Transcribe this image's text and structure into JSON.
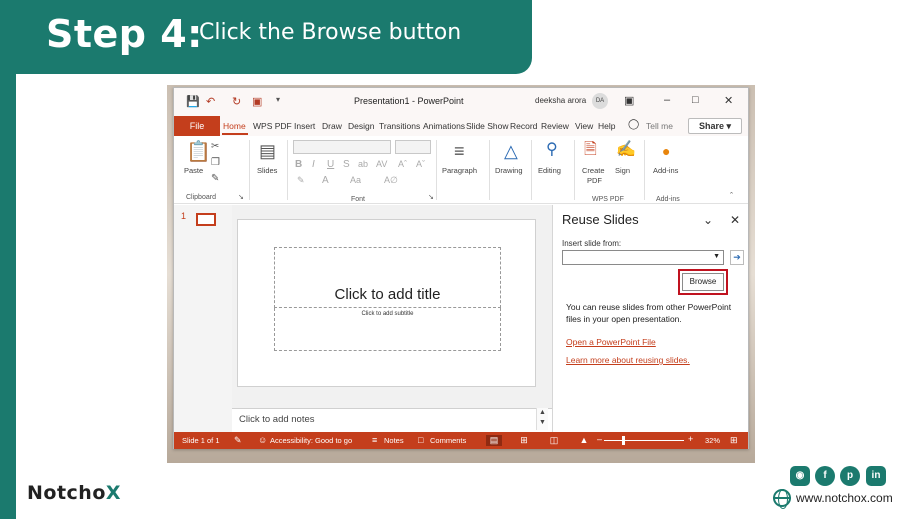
{
  "banner": {
    "step": "Step 4:",
    "instruction": "Click the Browse button"
  },
  "window": {
    "title": "Presentation1  -  PowerPoint",
    "user_name": "deeksha arora",
    "user_initials": "DA",
    "quick_access": [
      "save-icon",
      "undo-icon",
      "redo-icon",
      "present-icon"
    ]
  },
  "tabs": {
    "file": "File",
    "items": [
      "Home",
      "WPS PDF",
      "Insert",
      "Draw",
      "Design",
      "Transitions",
      "Animations",
      "Slide Show",
      "Record",
      "Review",
      "View",
      "Help"
    ],
    "active": "Home",
    "tell_me": "Tell me",
    "share": "Share"
  },
  "ribbon": {
    "paste": "Paste",
    "clipboard": "Clipboard",
    "slides": "Slides",
    "font": "Font",
    "paragraph": "Paragraph",
    "drawing": "Drawing",
    "editing": "Editing",
    "create_pdf_line1": "Create",
    "create_pdf_line2": "PDF",
    "sign": "Sign",
    "wps_pdf": "WPS PDF",
    "addins": "Add-ins",
    "addins_group": "Add-ins"
  },
  "thumbnails": {
    "slide_number": "1"
  },
  "slide": {
    "title_placeholder": "Click to add title",
    "subtitle_placeholder": "Click to add subtitle"
  },
  "notes": {
    "placeholder": "Click to add notes"
  },
  "reuse_slides": {
    "title": "Reuse Slides",
    "insert_from": "Insert slide from:",
    "select_value": "",
    "browse": "Browse",
    "description": "You can reuse slides from other PowerPoint files in your open presentation.",
    "open_link": "Open a PowerPoint File",
    "learn_link": "Learn more about reusing slides."
  },
  "status_bar": {
    "slide_of": "Slide 1 of 1",
    "accessibility": "Accessibility: Good to go",
    "notes": "Notes",
    "comments": "Comments",
    "zoom": "32%"
  },
  "footer": {
    "logo_prefix": "Notch",
    "logo_o": "o",
    "logo_x": "X",
    "website": "www.notchox.com",
    "social": [
      "instagram-icon",
      "facebook-icon",
      "pinterest-icon",
      "linkedin-icon"
    ]
  },
  "colors": {
    "brand": "#1b7a6e",
    "office_accent": "#c43e1c",
    "highlight": "#c0121f"
  }
}
